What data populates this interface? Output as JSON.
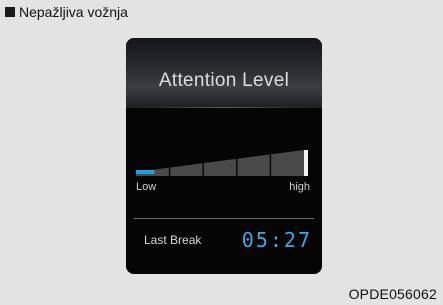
{
  "caption": {
    "text": "Nepažljiva vožnja"
  },
  "screen": {
    "title": "Attention Level",
    "level_low_label": "Low",
    "level_high_label": "high",
    "attention_level": 0.11,
    "bar_segments": 5,
    "active_color": "#1fa0e0",
    "last_break_label": "Last Break",
    "last_break_value": "05:27"
  },
  "footer": {
    "code": "OPDE056062"
  }
}
